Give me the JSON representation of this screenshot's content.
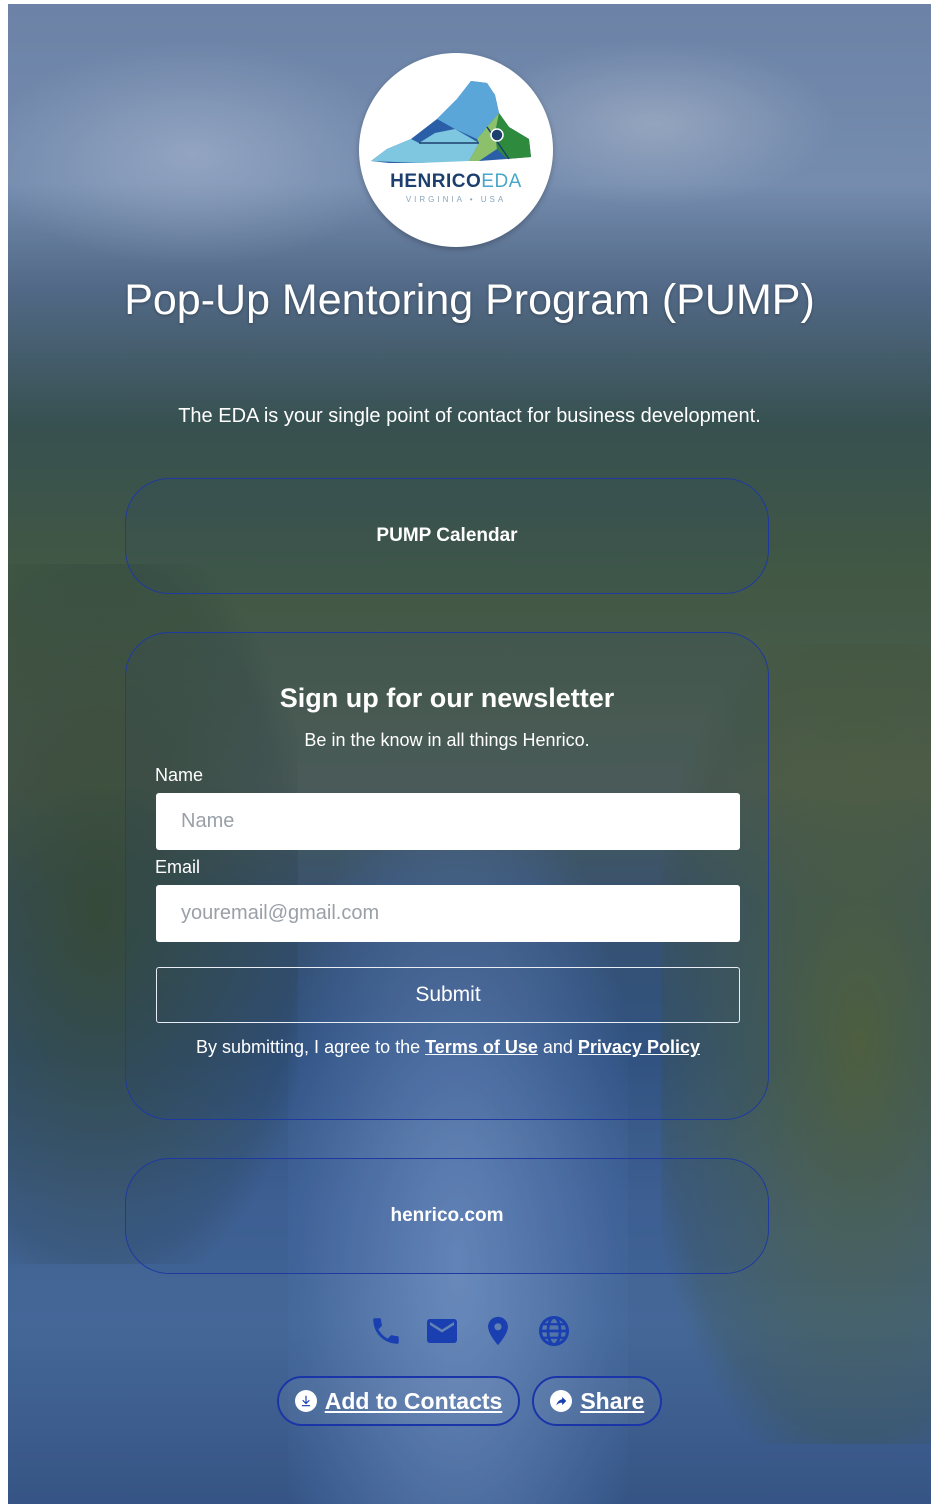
{
  "brand": {
    "name_part1": "HENRICO",
    "name_part2": "EDA",
    "subline": "VIRGINIA • USA"
  },
  "header": {
    "title": "Pop-Up Mentoring Program (PUMP)",
    "tagline": "The EDA is your single point of contact for business development."
  },
  "links": {
    "calendar": "PUMP Calendar",
    "website": "henrico.com"
  },
  "newsletter": {
    "title": "Sign up for our newsletter",
    "subtitle": "Be in the know in all things Henrico.",
    "name_label": "Name",
    "name_placeholder": "Name",
    "name_value": "",
    "email_label": "Email",
    "email_placeholder": "youremail@gmail.com",
    "email_value": "",
    "submit_label": "Submit",
    "legal_prefix": "By submitting, I agree to the ",
    "terms_label": "Terms of Use",
    "legal_and": " and ",
    "privacy_label": "Privacy Policy"
  },
  "contact_icons": [
    "phone-icon",
    "mail-icon",
    "location-pin-icon",
    "globe-icon"
  ],
  "actions": {
    "add_contacts_label": "Add to Contacts",
    "share_label": "Share"
  },
  "colors": {
    "accent_border": "#1e3aa0",
    "icon_blue": "#1a3fb0",
    "logo_navy": "#1c3f6e",
    "logo_teal": "#47a6c9"
  }
}
